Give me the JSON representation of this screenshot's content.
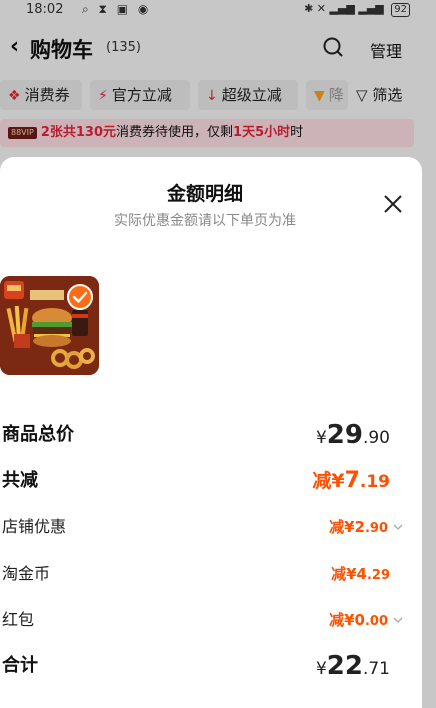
{
  "status_bar": {
    "time": "18:02",
    "left_icons": "⌕ ⧗ ▣ ◉",
    "right_icons": "✱ ✕ ▂▄▆ ▂▄▆",
    "battery": "92"
  },
  "navbar": {
    "back_icon": "chevron-left-icon",
    "title": "购物车",
    "count": "(135)",
    "search_icon": "search-icon",
    "manage": "管理"
  },
  "filters": {
    "chips": [
      {
        "icon": "coupon-icon",
        "glyph": "❖",
        "color": "#e0263c",
        "label": "消费券"
      },
      {
        "icon": "lightning-icon",
        "glyph": "⚡",
        "color": "#e0263c",
        "label": "官方立减"
      },
      {
        "icon": "arrow-down-icon",
        "glyph": "↓",
        "color": "#e0263c",
        "label": "超级立减"
      },
      {
        "icon": "price-drop-icon",
        "glyph": "▼",
        "color": "#f2a01e",
        "label": "降"
      }
    ],
    "filter_label": "筛选",
    "filter_icon": "funnel-icon"
  },
  "notice": {
    "badge": "88VIP",
    "highlight_1": "2张共130元",
    "text_1": "消费券待使用，仅剩",
    "highlight_2": "1天5小时",
    "text_2": "时"
  },
  "sheet": {
    "title": "金额明细",
    "subtitle": "实际优惠金额请以下单页为准",
    "close_icon": "close-icon",
    "product_image": "burger-meal-image",
    "checked_icon": "checkmark-icon",
    "rows": {
      "goods_total": {
        "label": "商品总价",
        "yen": "¥",
        "int": "29",
        "dec": ".90"
      },
      "total_discount": {
        "label": "共减",
        "prefix": "减¥",
        "int": "7",
        "dec": ".19"
      },
      "store_discount": {
        "label": "店铺优惠",
        "prefix": "减¥",
        "int": "2",
        "dec": ".90"
      },
      "taojinbi": {
        "label": "淘金币",
        "prefix": "减¥",
        "int": "4",
        "dec": ".29"
      },
      "red_packet": {
        "label": "红包",
        "prefix": "减¥",
        "int": "0",
        "dec": ".00"
      },
      "sum": {
        "label": "合计",
        "yen": "¥",
        "int": "22",
        "dec": ".71"
      }
    }
  },
  "colors": {
    "accent_orange": "#ff5000",
    "brand_red": "#e0263c",
    "notice_bg": "#f8dbe0"
  }
}
